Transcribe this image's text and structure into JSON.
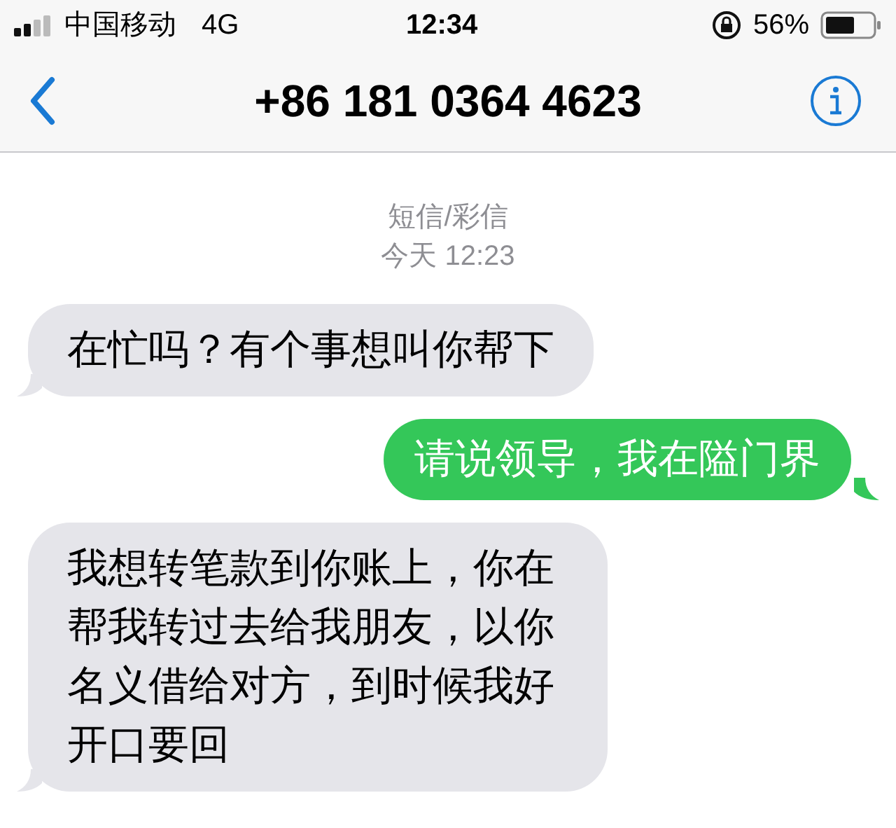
{
  "status_bar": {
    "carrier": "中国移动",
    "network": "4G",
    "time": "12:34",
    "battery": "56%"
  },
  "nav_bar": {
    "title": "+86 181 0364 4623"
  },
  "conversation": {
    "service": "短信/彩信",
    "timestamp": "今天 12:23",
    "messages": [
      {
        "kind": "incoming",
        "text": "在忙吗？有个事想叫你帮下"
      },
      {
        "kind": "outgoing",
        "text": "请说领导，我在隘门界"
      },
      {
        "kind": "incoming",
        "text": "我想转笔款到你账上，你在帮我转过去给我朋友，以你名义借给对方，到时候我好开口要回"
      }
    ]
  }
}
